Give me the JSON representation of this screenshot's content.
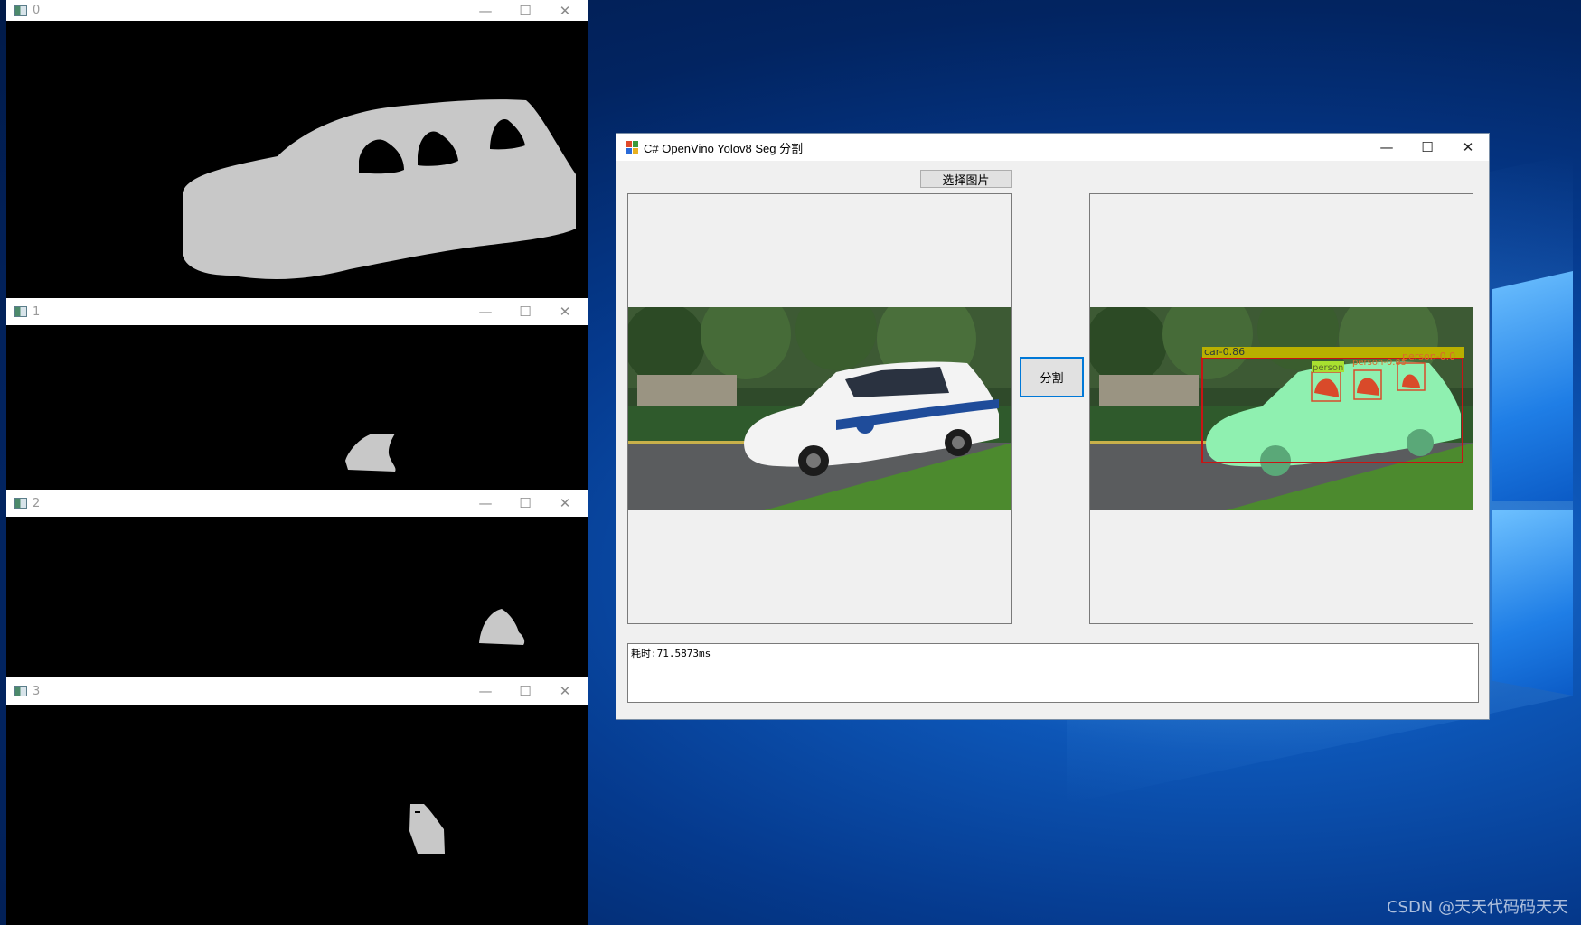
{
  "cv_windows": [
    {
      "title": "0"
    },
    {
      "title": "1"
    },
    {
      "title": "2"
    },
    {
      "title": "3"
    }
  ],
  "cv_controls": {
    "minimize": "—",
    "maximize": "☐",
    "close": "✕"
  },
  "main_window": {
    "title": "C# OpenVino Yolov8 Seg 分割",
    "select_image_button": "选择图片",
    "segment_button": "分割",
    "log_text": "耗时:71.5873ms",
    "detections": [
      {
        "label": "car-0.86"
      },
      {
        "label": "person-0.0"
      },
      {
        "label": "person"
      },
      {
        "label": "person-0.85"
      }
    ]
  },
  "colors": {
    "mask": "#c8c8c8",
    "car_overlay": "#8ff0b0",
    "person_overlay": "#d94a2a",
    "box_red": "#c81414",
    "label_bar": "#b8b000"
  },
  "watermark": "CSDN @天天代码码天天"
}
